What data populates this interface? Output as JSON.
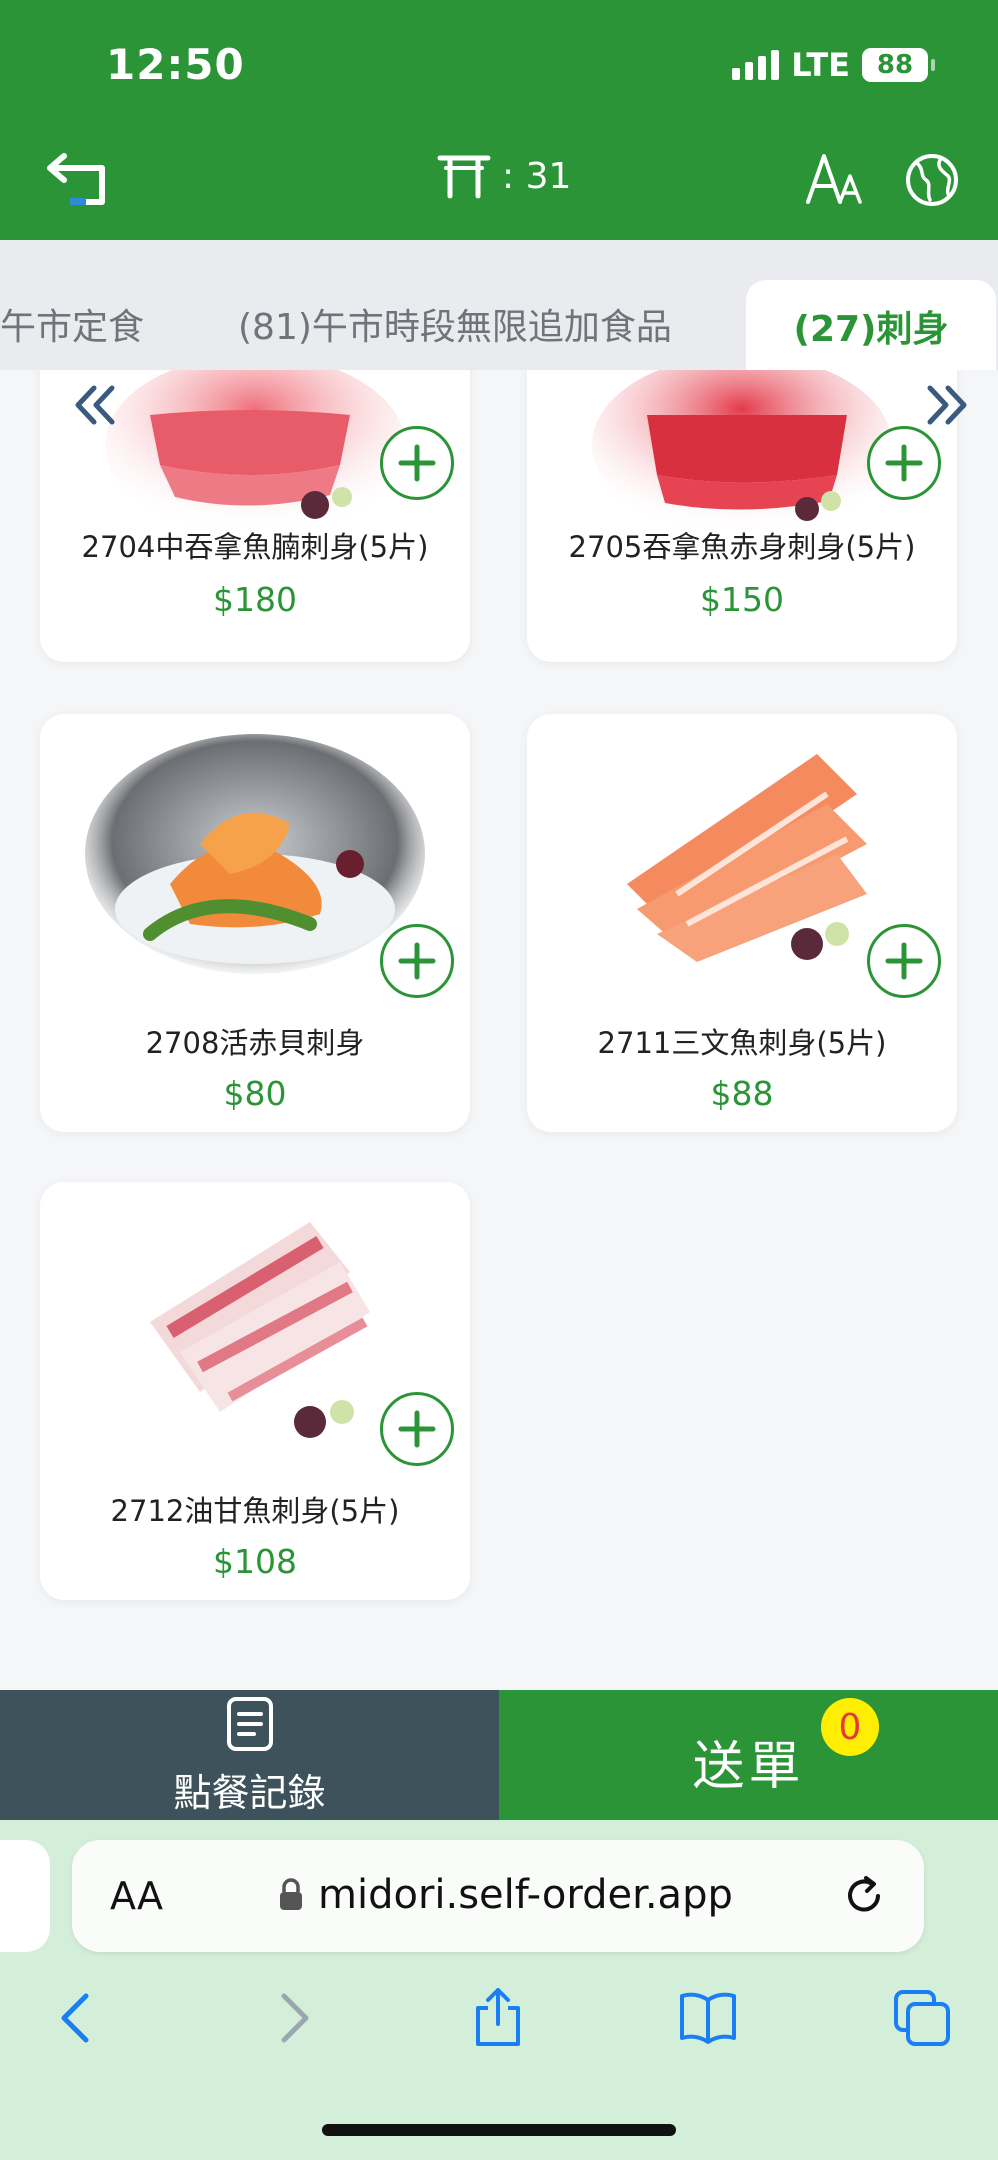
{
  "status_bar": {
    "time": "12:50",
    "network": "LTE",
    "battery": "88"
  },
  "header": {
    "table_label": ": 31"
  },
  "tabs": [
    {
      "label": "午市定食"
    },
    {
      "label": "(81)午市時段無限追加食品"
    },
    {
      "label": "(27)刺身",
      "active": true
    }
  ],
  "products": [
    {
      "name": "2704中吞拿魚腩刺身(5片)",
      "price": "$180",
      "image": "tuna-belly-sashimi"
    },
    {
      "name": "2705吞拿魚赤身刺身(5片)",
      "price": "$150",
      "image": "tuna-lean-sashimi"
    },
    {
      "name": "2708活赤貝刺身",
      "price": "$80",
      "image": "ark-shell-sashimi"
    },
    {
      "name": "2711三文魚刺身(5片)",
      "price": "$88",
      "image": "salmon-sashimi"
    },
    {
      "name": "2712油甘魚刺身(5片)",
      "price": "$108",
      "image": "yellowtail-sashimi"
    }
  ],
  "bottom_bar": {
    "history_label": "點餐記錄",
    "send_label": "送單",
    "cart_count": "0"
  },
  "browser": {
    "text_size_label": "AA",
    "url": "midori.self-order.app"
  },
  "colors": {
    "brand_green": "#2b9437",
    "history_bg": "#3e525c",
    "badge": "#ffee00",
    "badge_text": "#e53935"
  }
}
